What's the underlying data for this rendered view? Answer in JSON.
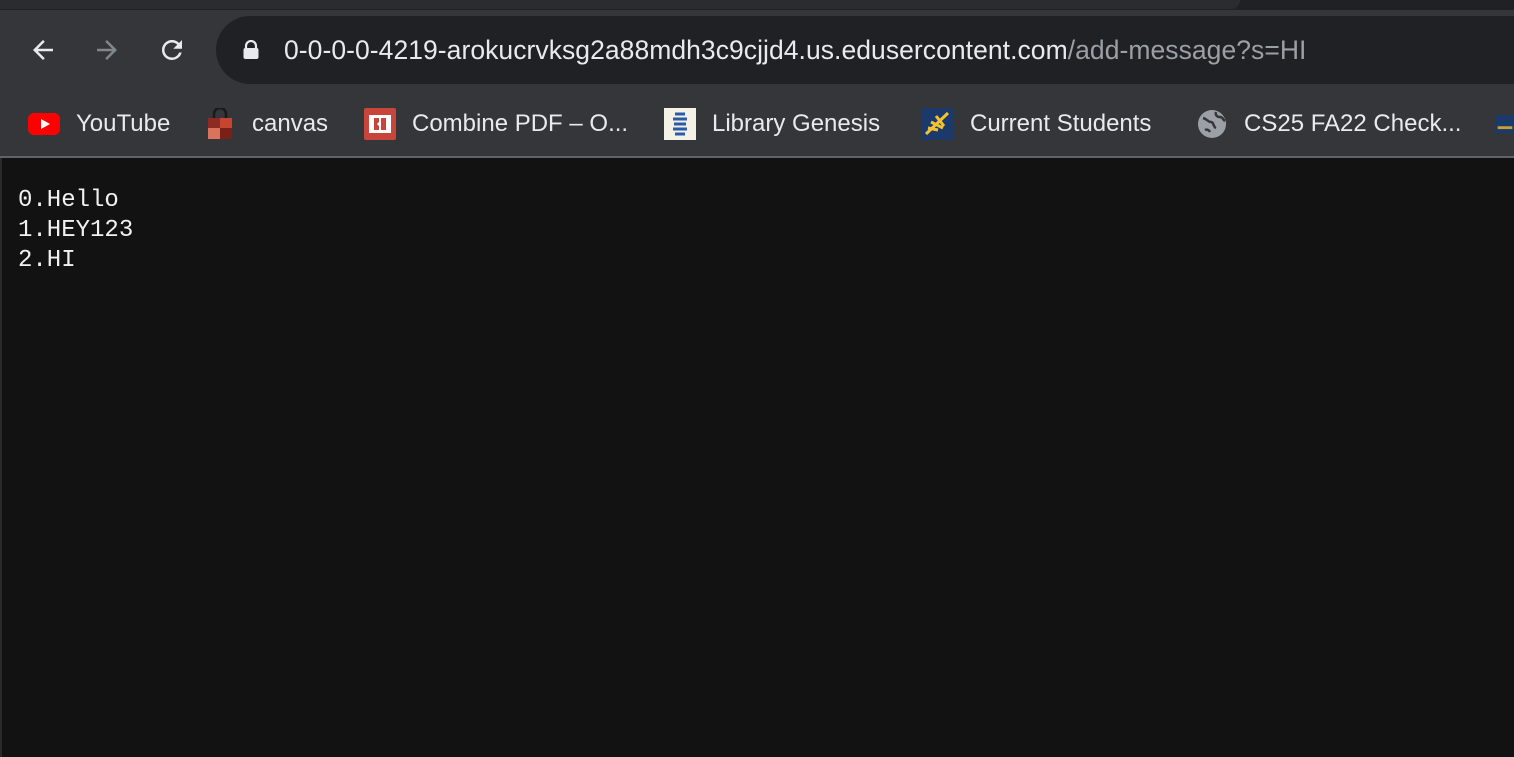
{
  "browser": {
    "nav": {
      "back_icon": "arrow-left-icon",
      "forward_icon": "arrow-right-icon",
      "reload_icon": "reload-icon"
    },
    "address_bar": {
      "lock_icon": "lock-icon",
      "host": "0-0-0-0-4219-arokucrvksg2a88mdh3c9cjjd4.us.edusercontent.com",
      "path": "/add-message?s=HI"
    },
    "bookmarks": [
      {
        "label": "YouTube",
        "icon": "youtube-icon"
      },
      {
        "label": "canvas",
        "icon": "canvas-icon"
      },
      {
        "label": "Combine PDF – O...",
        "icon": "combine-pdf-icon"
      },
      {
        "label": "Library Genesis",
        "icon": "library-genesis-icon"
      },
      {
        "label": "Current Students",
        "icon": "current-students-icon"
      },
      {
        "label": "CS25 FA22 Check...",
        "icon": "globe-icon"
      }
    ],
    "colors": {
      "toolbar": "#35363a",
      "omnibox": "#202124",
      "page_background": "#121212",
      "text": "#e8eaed",
      "url_path": "#9aa0a6",
      "youtube_red": "#ff0000"
    }
  },
  "page": {
    "messages": [
      "0.Hello",
      "1.HEY123",
      "2.HI"
    ]
  }
}
